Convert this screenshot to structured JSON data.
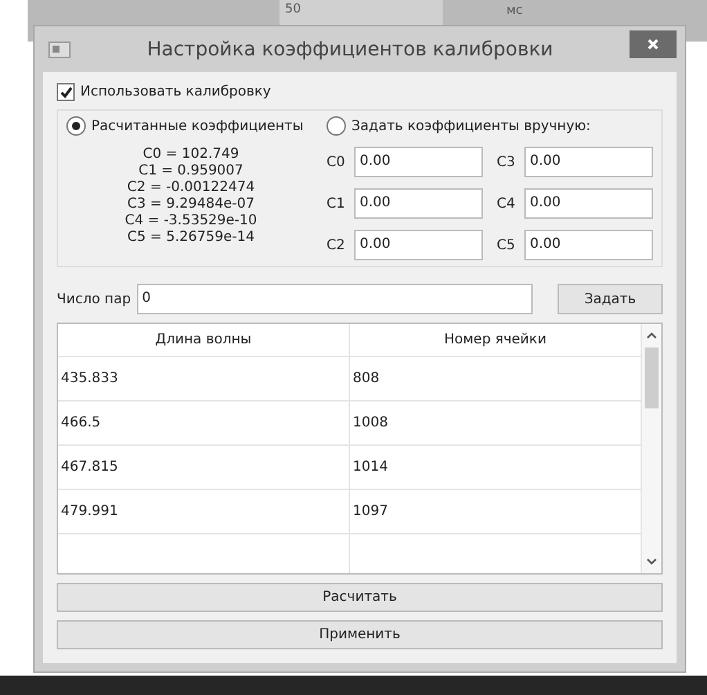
{
  "background_window": {
    "fields": [
      "50",
      "мс"
    ]
  },
  "window": {
    "title": "Настройка коэффициентов калибровки"
  },
  "use_calibration": {
    "label": "Использовать калибровку",
    "checked": true
  },
  "modes": [
    {
      "label": "Расчитанные коэффициенты",
      "selected": true
    },
    {
      "label": "Задать коэффициенты вручную:",
      "selected": false
    }
  ],
  "computed": [
    "C0 = 102.749",
    "C1 = 0.959007",
    "C2 = -0.00122474",
    "C3 = 9.29484e-07",
    "C4 = -3.53529e-10",
    "C5 = 5.26759e-14"
  ],
  "manual": [
    {
      "label": "C0",
      "value": "0.00"
    },
    {
      "label": "C3",
      "value": "0.00"
    },
    {
      "label": "C1",
      "value": "0.00"
    },
    {
      "label": "C4",
      "value": "0.00"
    },
    {
      "label": "C2",
      "value": "0.00"
    },
    {
      "label": "C5",
      "value": "0.00"
    }
  ],
  "pairs": {
    "label": "Число пар",
    "value": "0",
    "button": "Задать"
  },
  "table": {
    "columns": [
      "Длина волны",
      "Номер ячейки"
    ],
    "rows": [
      [
        "435.833",
        "808"
      ],
      [
        "466.5",
        "1008"
      ],
      [
        "467.815",
        "1014"
      ],
      [
        "479.991",
        "1097"
      ]
    ]
  },
  "buttons": [
    "Расчитать",
    "Применить"
  ]
}
